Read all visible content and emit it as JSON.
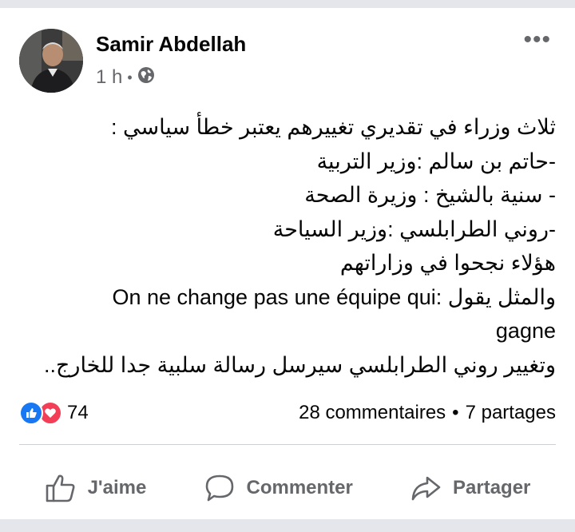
{
  "post": {
    "author": "Samir Abdellah",
    "time": "1 h",
    "separator": "•",
    "privacy_icon": "globe-icon",
    "more_icon": "more-options-icon",
    "lines": [
      "ثلاث وزراء في تقديري تغييرهم يعتبر خطأ سياسي :",
      "-حاتم بن سالم :وزير التربية",
      "- سنية بالشيخ : وزيرة الصحة",
      "-روني الطرابلسي :وزير السياحة",
      "هؤلاء نجحوا في وزاراتهم",
      "والمثل يقول :On ne change pas une équipe qui",
      "gagne",
      "وتغيير روني الطرابلسي سيرسل رسالة سلبية جدا للخارج.."
    ]
  },
  "reactions": {
    "icons": [
      "like-icon",
      "love-icon"
    ],
    "count": "74",
    "like_color": "#1877f2",
    "love_color": "#f33e58"
  },
  "stats": {
    "comments": "28 commentaires",
    "separator": "•",
    "shares": "7 partages"
  },
  "actions": {
    "like_label": "J'aime",
    "comment_label": "Commenter",
    "share_label": "Partager"
  },
  "colors": {
    "text": "#050505",
    "secondary": "#65676b",
    "divider": "#ced0d4",
    "background": "#e4e6eb"
  }
}
